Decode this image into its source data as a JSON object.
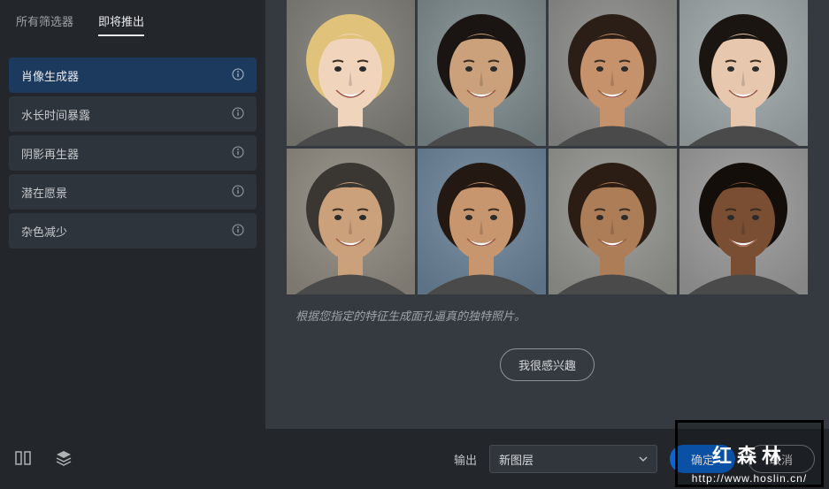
{
  "sidebar": {
    "tabs": {
      "all": "所有筛选器",
      "upcoming": "即将推出"
    },
    "items": [
      {
        "label": "肖像生成器"
      },
      {
        "label": "水长时间暴露"
      },
      {
        "label": "阴影再生器"
      },
      {
        "label": "潜在愿景"
      },
      {
        "label": "杂色减少"
      }
    ]
  },
  "content": {
    "caption": "根据您指定的特征生成面孔逼真的独特照片。",
    "interest_label": "我很感兴趣"
  },
  "footer": {
    "output_label": "输出",
    "select_value": "新图层",
    "ok_label": "确定",
    "cancel_label": "取消"
  },
  "watermark": {
    "line1": "红森林",
    "line2": "http://www.hoslin.cn/"
  },
  "faces": [
    {
      "bg1": "#8d8c86",
      "bg2": "#6f6e68",
      "skin": "#f1d4bc",
      "hair": "#e0c27a"
    },
    {
      "bg1": "#8f9a9c",
      "bg2": "#6c777a",
      "skin": "#caa17a",
      "hair": "#1a1412"
    },
    {
      "bg1": "#9a9b99",
      "bg2": "#7a7b79",
      "skin": "#c6926c",
      "hair": "#2a1e16"
    },
    {
      "bg1": "#aab1b2",
      "bg2": "#8a9192",
      "skin": "#e7c8ae",
      "hair": "#1b1512"
    },
    {
      "bg1": "#9c9890",
      "bg2": "#7c7870",
      "skin": "#caa17a",
      "hair": "#3a3632"
    },
    {
      "bg1": "#7d93a5",
      "bg2": "#5d7385",
      "skin": "#c7966e",
      "hair": "#241812"
    },
    {
      "bg1": "#a1a29e",
      "bg2": "#81827e",
      "skin": "#ad7d58",
      "hair": "#2b1d14"
    },
    {
      "bg1": "#a6a6a6",
      "bg2": "#868686",
      "skin": "#7a4e32",
      "hair": "#140e0a"
    }
  ]
}
